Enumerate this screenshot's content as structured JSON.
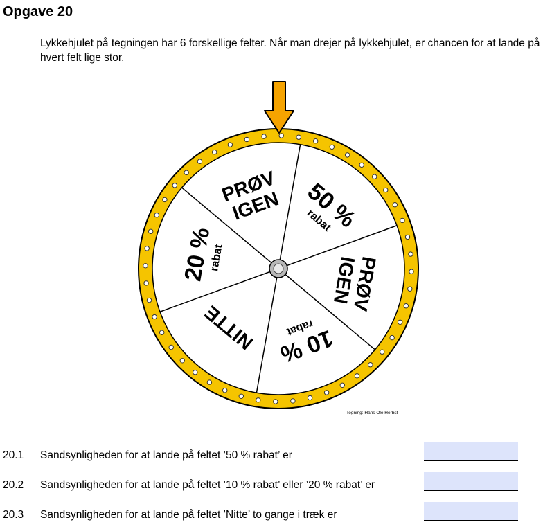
{
  "task": {
    "title": "Opgave 20",
    "intro": "Lykkehjulet på tegningen har 6 forskellige felter. Når man drejer på lykkehjulet, er chancen for at lande på hvert felt lige stor."
  },
  "wheel": {
    "segments": [
      {
        "id": "proev-igen-top",
        "lines": [
          "PRØV",
          "IGEN"
        ]
      },
      {
        "id": "50-rabat",
        "lines": [
          "50 %"
        ],
        "sub": "rabat"
      },
      {
        "id": "proev-igen-right",
        "lines": [
          "PRØV",
          "IGEN"
        ]
      },
      {
        "id": "10-rabat",
        "lines": [
          "10 %"
        ],
        "sub": "rabat"
      },
      {
        "id": "nitte",
        "lines": [
          "NITTE"
        ]
      },
      {
        "id": "20-rabat",
        "lines": [
          "20 %"
        ],
        "sub": "rabat"
      }
    ],
    "colors": {
      "rim": "#f5c400",
      "arrow": "#f5a300",
      "hub": "#b8b8b8"
    },
    "credit": "Tegning: Hans Ole Herbst"
  },
  "questions": [
    {
      "number": "20.1",
      "text": "Sandsynligheden for at lande på feltet ’50 % rabat’ er"
    },
    {
      "number": "20.2",
      "text": "Sandsynligheden for at lande på feltet ’10 % rabat’ eller ’20 % rabat’ er"
    },
    {
      "number": "20.3",
      "text": "Sandsynligheden for at lande på feltet ’Nitte’ to gange i træk er"
    }
  ]
}
